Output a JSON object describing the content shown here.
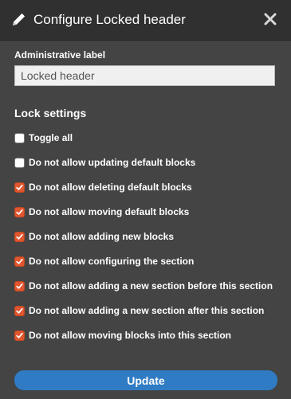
{
  "dialog": {
    "title": "Configure Locked header",
    "title_icon": "pencil-icon",
    "close_icon": "close-icon"
  },
  "form": {
    "admin_label": {
      "label": "Administrative label",
      "value": "Locked header"
    },
    "lock_settings": {
      "heading": "Lock settings",
      "items": [
        {
          "label": "Toggle all",
          "checked": false
        },
        {
          "label": "Do not allow updating default blocks",
          "checked": false
        },
        {
          "label": "Do not allow deleting default blocks",
          "checked": true
        },
        {
          "label": "Do not allow moving default blocks",
          "checked": true
        },
        {
          "label": "Do not allow adding new blocks",
          "checked": true
        },
        {
          "label": "Do not allow configuring the section",
          "checked": true
        },
        {
          "label": "Do not allow adding a new section before this section",
          "checked": true
        },
        {
          "label": "Do not allow adding a new section after this section",
          "checked": true
        },
        {
          "label": "Do not allow moving blocks into this section",
          "checked": true
        }
      ]
    },
    "submit_label": "Update"
  },
  "colors": {
    "dialog_bg": "#444444",
    "titlebar_bg": "#303030",
    "checkbox_checked": "#e0562f",
    "button_primary": "#2f7bc4"
  }
}
